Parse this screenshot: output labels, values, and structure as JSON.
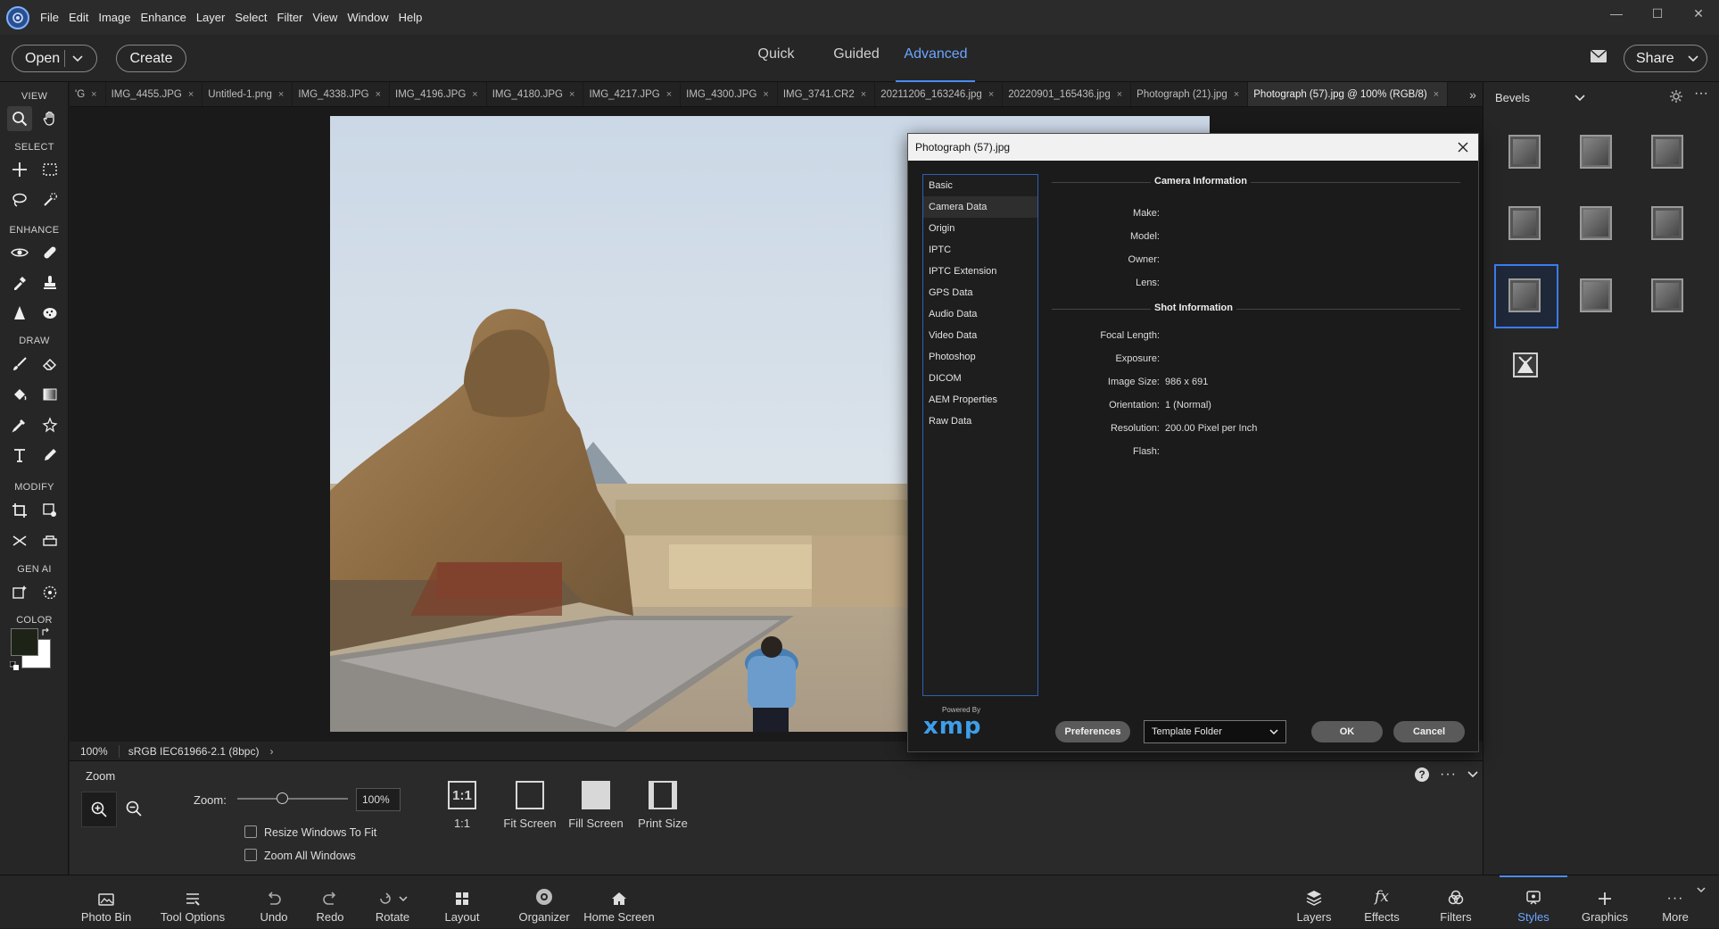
{
  "menu": [
    "File",
    "Edit",
    "Image",
    "Enhance",
    "Layer",
    "Select",
    "Filter",
    "View",
    "Window",
    "Help"
  ],
  "window_controls": {
    "minimize": "—",
    "maximize": "☐",
    "close": "✕"
  },
  "modebar": {
    "open_label": "Open",
    "create_label": "Create",
    "modes": [
      "Quick",
      "Guided",
      "Advanced"
    ],
    "active_mode": "Advanced",
    "share_label": "Share"
  },
  "toolbar": {
    "sections": {
      "view": "VIEW",
      "select": "SELECT",
      "enhance": "ENHANCE",
      "draw": "DRAW",
      "modify": "MODIFY",
      "genai": "GEN AI",
      "color": "COLOR"
    },
    "foreground_color": "#1e2318",
    "background_color": "#ffffff"
  },
  "tabs": [
    {
      "label": "'G"
    },
    {
      "label": "IMG_4455.JPG"
    },
    {
      "label": "Untitled-1.png"
    },
    {
      "label": "IMG_4338.JPG"
    },
    {
      "label": "IMG_4196.JPG"
    },
    {
      "label": "IMG_4180.JPG"
    },
    {
      "label": "IMG_4217.JPG"
    },
    {
      "label": "IMG_4300.JPG"
    },
    {
      "label": "IMG_3741.CR2"
    },
    {
      "label": "20211206_163246.jpg"
    },
    {
      "label": "20220901_165436.jpg"
    },
    {
      "label": "Photograph (21).jpg"
    },
    {
      "label": "Photograph (57).jpg @ 100% (RGB/8)"
    }
  ],
  "tab_close": "×",
  "tab_more": "»",
  "status": {
    "zoom": "100%",
    "profile": "sRGB IEC61966-2.1 (8bpc)",
    "arrow": "›"
  },
  "tool_options": {
    "title": "Zoom",
    "zoom_label": "Zoom:",
    "zoom_value": "100%",
    "zoom_slider_fraction": 0.4,
    "resize_windows_label": "Resize Windows To Fit",
    "zoom_all_label": "Zoom All Windows",
    "btn_1to1": "1:1",
    "btn_1to1_icon": "1:1",
    "btn_fit": "Fit Screen",
    "btn_fill": "Fill Screen",
    "btn_print": "Print Size"
  },
  "right_panel": {
    "title": "Bevels"
  },
  "bottom": [
    {
      "key": "photo_bin",
      "label": "Photo Bin"
    },
    {
      "key": "tool_options",
      "label": "Tool Options"
    },
    {
      "key": "undo",
      "label": "Undo"
    },
    {
      "key": "redo",
      "label": "Redo"
    },
    {
      "key": "rotate",
      "label": "Rotate"
    },
    {
      "key": "layout",
      "label": "Layout"
    },
    {
      "key": "organizer",
      "label": "Organizer"
    },
    {
      "key": "home",
      "label": "Home Screen"
    },
    {
      "key": "layers",
      "label": "Layers"
    },
    {
      "key": "effects",
      "label": "Effects"
    },
    {
      "key": "filters",
      "label": "Filters"
    },
    {
      "key": "styles",
      "label": "Styles"
    },
    {
      "key": "graphics",
      "label": "Graphics"
    },
    {
      "key": "more",
      "label": "More"
    }
  ],
  "bottom_active": "Styles",
  "dialog": {
    "title": "Photograph (57).jpg",
    "categories": [
      "Basic",
      "Camera Data",
      "Origin",
      "IPTC",
      "IPTC Extension",
      "GPS Data",
      "Audio Data",
      "Video Data",
      "Photoshop",
      "DICOM",
      "AEM Properties",
      "Raw Data"
    ],
    "selected_category": "Camera Data",
    "camera_heading": "Camera Information",
    "camera_fields": [
      {
        "label": "Make:",
        "value": ""
      },
      {
        "label": "Model:",
        "value": ""
      },
      {
        "label": "Owner:",
        "value": ""
      },
      {
        "label": "Lens:",
        "value": ""
      }
    ],
    "shot_heading": "Shot Information",
    "shot_fields": [
      {
        "label": "Focal Length:",
        "value": ""
      },
      {
        "label": "Exposure:",
        "value": ""
      },
      {
        "label": "Image Size:",
        "value": "986 x 691"
      },
      {
        "label": "Orientation:",
        "value": "1 (Normal)"
      },
      {
        "label": "Resolution:",
        "value": "200.00 Pixel per Inch"
      },
      {
        "label": "Flash:",
        "value": ""
      }
    ],
    "powered_by": "Powered By",
    "xmp": "xmp",
    "preferences_label": "Preferences",
    "template_select": "Template Folder",
    "ok_label": "OK",
    "cancel_label": "Cancel"
  }
}
